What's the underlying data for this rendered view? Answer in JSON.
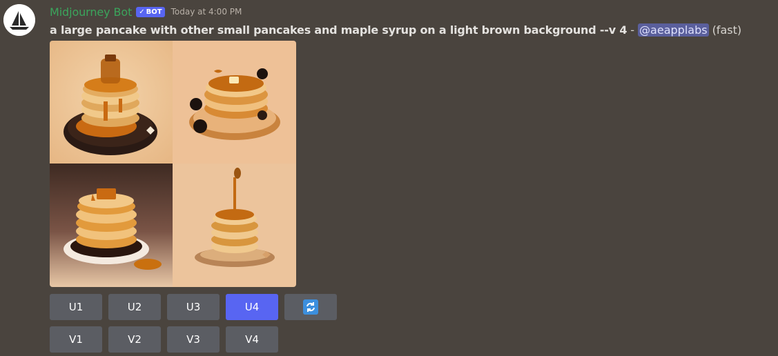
{
  "message": {
    "author": "Midjourney Bot",
    "bot_tag": "BOT",
    "bot_tag_check": "✓",
    "timestamp": "Today at 4:00 PM",
    "prompt": "a large pancake with other small pancakes and maple syrup on a light brown background --v 4",
    "separator": "-",
    "mention": "@aeapplabs",
    "speed": "(fast)"
  },
  "image_grid": {
    "tiles": [
      {
        "name": "pancake-stack-with-syrup-jar"
      },
      {
        "name": "pancake-stack-with-syrup-drips"
      },
      {
        "name": "tall-pancake-stack-on-plate"
      },
      {
        "name": "pancake-stack-with-honey-dipper"
      }
    ]
  },
  "buttons": {
    "upscale": [
      "U1",
      "U2",
      "U3",
      "U4"
    ],
    "variation": [
      "V1",
      "V2",
      "V3",
      "V4"
    ],
    "reroll_icon": "refresh-icon",
    "active": "U4"
  },
  "colors": {
    "background": "#4a443e",
    "username": "#3ba55c",
    "accent": "#5865f2",
    "button": "#5b5d63",
    "mention_bg": "#5a5f9c"
  }
}
